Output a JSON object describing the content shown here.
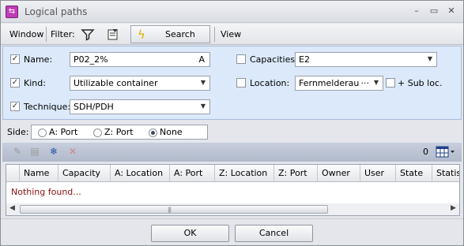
{
  "window": {
    "title": "Logical paths"
  },
  "menubar": {
    "window_label": "Window",
    "filter_label": "Filter:",
    "search_label": "Search",
    "view_label": "View"
  },
  "filters": {
    "name": {
      "label": "Name:",
      "checked": true,
      "value": "P02_2%",
      "suffix": "A"
    },
    "kind": {
      "label": "Kind:",
      "checked": true,
      "value": "Utilizable container"
    },
    "technique": {
      "label": "Technique:",
      "checked": true,
      "value": "SDH/PDH"
    },
    "capacities": {
      "label": "Capacities:",
      "checked": false,
      "value": "E2"
    },
    "location": {
      "label": "Location:",
      "checked": false,
      "value": "Fernmelderaum",
      "more": "···"
    },
    "sub_loc": {
      "label": "+ Sub loc.",
      "checked": false
    }
  },
  "side": {
    "label": "Side:",
    "options": [
      "A: Port",
      "Z: Port",
      "None"
    ],
    "selected": "None"
  },
  "results": {
    "count": "0",
    "columns": [
      "",
      "Name",
      "Capacity",
      "A: Location",
      "A: Port",
      "Z: Location",
      "Z: Port",
      "Owner",
      "User",
      "State",
      "Statist"
    ],
    "empty_text": "Nothing found..."
  },
  "buttons": {
    "ok": "OK",
    "cancel": "Cancel"
  }
}
